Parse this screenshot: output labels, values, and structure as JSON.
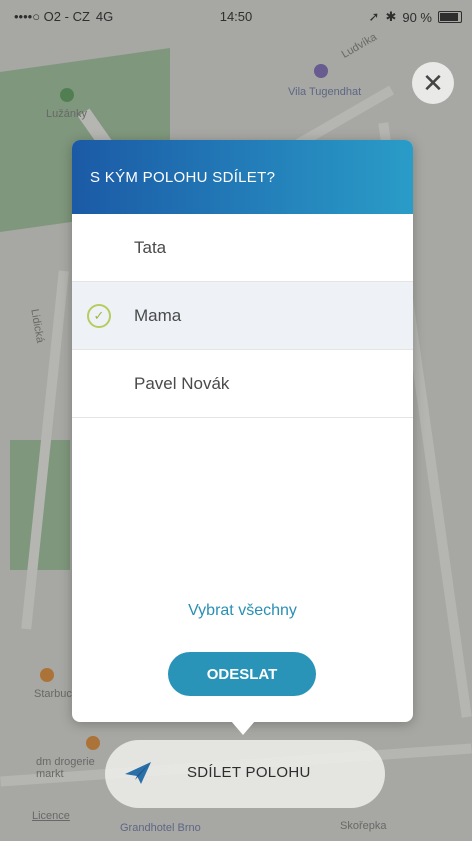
{
  "status_bar": {
    "carrier": "••••○ O2 - CZ",
    "network": "4G",
    "time": "14:50",
    "battery": "90 %"
  },
  "map": {
    "labels": [
      "Lužánky",
      "Vila Tugendhat",
      "Ludvíka",
      "Lidická",
      "Grandhotel Brno",
      "Starbucks",
      "dm drogerie markt",
      "Skořepka",
      "Licence"
    ]
  },
  "modal": {
    "title": "S KÝM POLOHU SDÍLET?",
    "contacts": [
      {
        "name": "Tata",
        "selected": false
      },
      {
        "name": "Mama",
        "selected": true
      },
      {
        "name": "Pavel Novák",
        "selected": false
      }
    ],
    "select_all_label": "Vybrat všechny",
    "send_label": "ODESLAT"
  },
  "share_bar": {
    "label": "SDÍLET POLOHU"
  },
  "colors": {
    "header_start": "#1b5aa6",
    "header_end": "#2a9cc8",
    "accent": "#2a93b8",
    "check": "#9bb842"
  }
}
